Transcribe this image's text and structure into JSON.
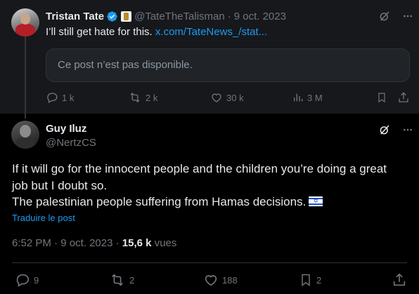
{
  "parent_tweet": {
    "author_name": "Tristan Tate",
    "handle": "@TateTheTalisman",
    "separator": "·",
    "date": "9 oct. 2023",
    "text": "I’ll still get hate for this.",
    "link": "x.com/TateNews_/stat...",
    "unavailable_notice": "Ce post n’est pas disponible.",
    "stats": {
      "replies": "1 k",
      "reposts": "2 k",
      "likes": "30 k",
      "views": "3 M"
    }
  },
  "reply_tweet": {
    "author_name": "Guy Iluz",
    "handle": "@NertzCS",
    "body_lines": [
      "If it will go for the innocent people and the children you’re doing a great",
      "job but I doubt so.",
      "The palestinian people suffering from Hamas decisions."
    ],
    "translate": "Traduire le post",
    "time": "6:52 PM",
    "separator": "·",
    "date": "9 oct. 2023",
    "separator2": "·",
    "views_count": "15,6 k",
    "views_label": "vues",
    "stats": {
      "replies": "9",
      "reposts": "2",
      "likes": "188",
      "bookmarks": "2"
    }
  },
  "colors": {
    "accent": "#1d9bf0",
    "muted": "#71767b",
    "text": "#e7e9ea",
    "background": "#000000",
    "parent_background": "#16181c"
  }
}
